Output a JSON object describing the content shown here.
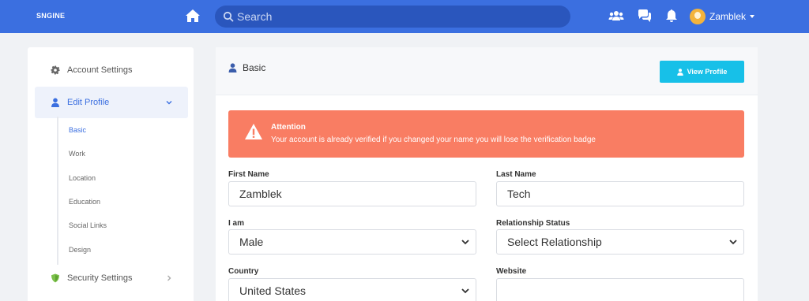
{
  "header": {
    "logo": "SNGINE",
    "search_placeholder": "Search",
    "username": "Zamblek"
  },
  "sidebar": {
    "account_settings": "Account Settings",
    "edit_profile": "Edit Profile",
    "sub_items": [
      "Basic",
      "Work",
      "Location",
      "Education",
      "Social Links",
      "Design"
    ],
    "security_settings": "Security Settings"
  },
  "main": {
    "title": "Basic",
    "view_profile": "View Profile",
    "alert": {
      "title": "Attention",
      "text": "Your account is already verified if you changed your name you will lose the verification badge"
    },
    "fields": {
      "first_name_label": "First Name",
      "first_name_value": "Zamblek",
      "last_name_label": "Last Name",
      "last_name_value": "Tech",
      "gender_label": "I am",
      "gender_value": "Male",
      "relationship_label": "Relationship Status",
      "relationship_value": "Select Relationship",
      "country_label": "Country",
      "country_value": "United States",
      "website_label": "Website",
      "website_value": ""
    }
  },
  "colors": {
    "brand": "#3b6fe0",
    "alert": "#f97d63",
    "button": "#17c0e8"
  }
}
